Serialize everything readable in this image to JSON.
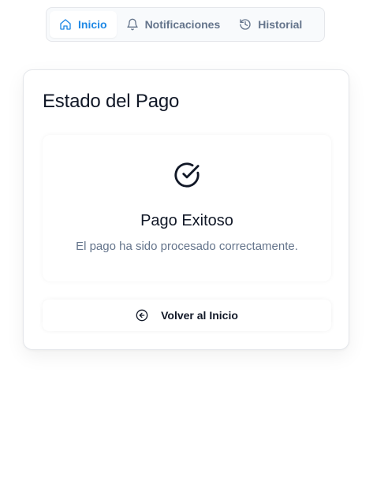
{
  "nav": {
    "tabs": [
      {
        "label": "Inicio",
        "icon": "home-icon",
        "active": true
      },
      {
        "label": "Notificaciones",
        "icon": "bell-icon",
        "active": false
      },
      {
        "label": "Historial",
        "icon": "history-icon",
        "active": false
      }
    ]
  },
  "card": {
    "title": "Estado del Pago",
    "status": {
      "icon": "check-circle-icon",
      "title": "Pago Exitoso",
      "message": "El pago ha sido procesado correctamente."
    },
    "back_button": {
      "icon": "arrow-left-circle-icon",
      "label": "Volver al Inicio"
    }
  },
  "colors": {
    "accent": "#1e88e5",
    "muted_text": "#64748b",
    "text": "#111827",
    "border": "#e5e7eb"
  }
}
